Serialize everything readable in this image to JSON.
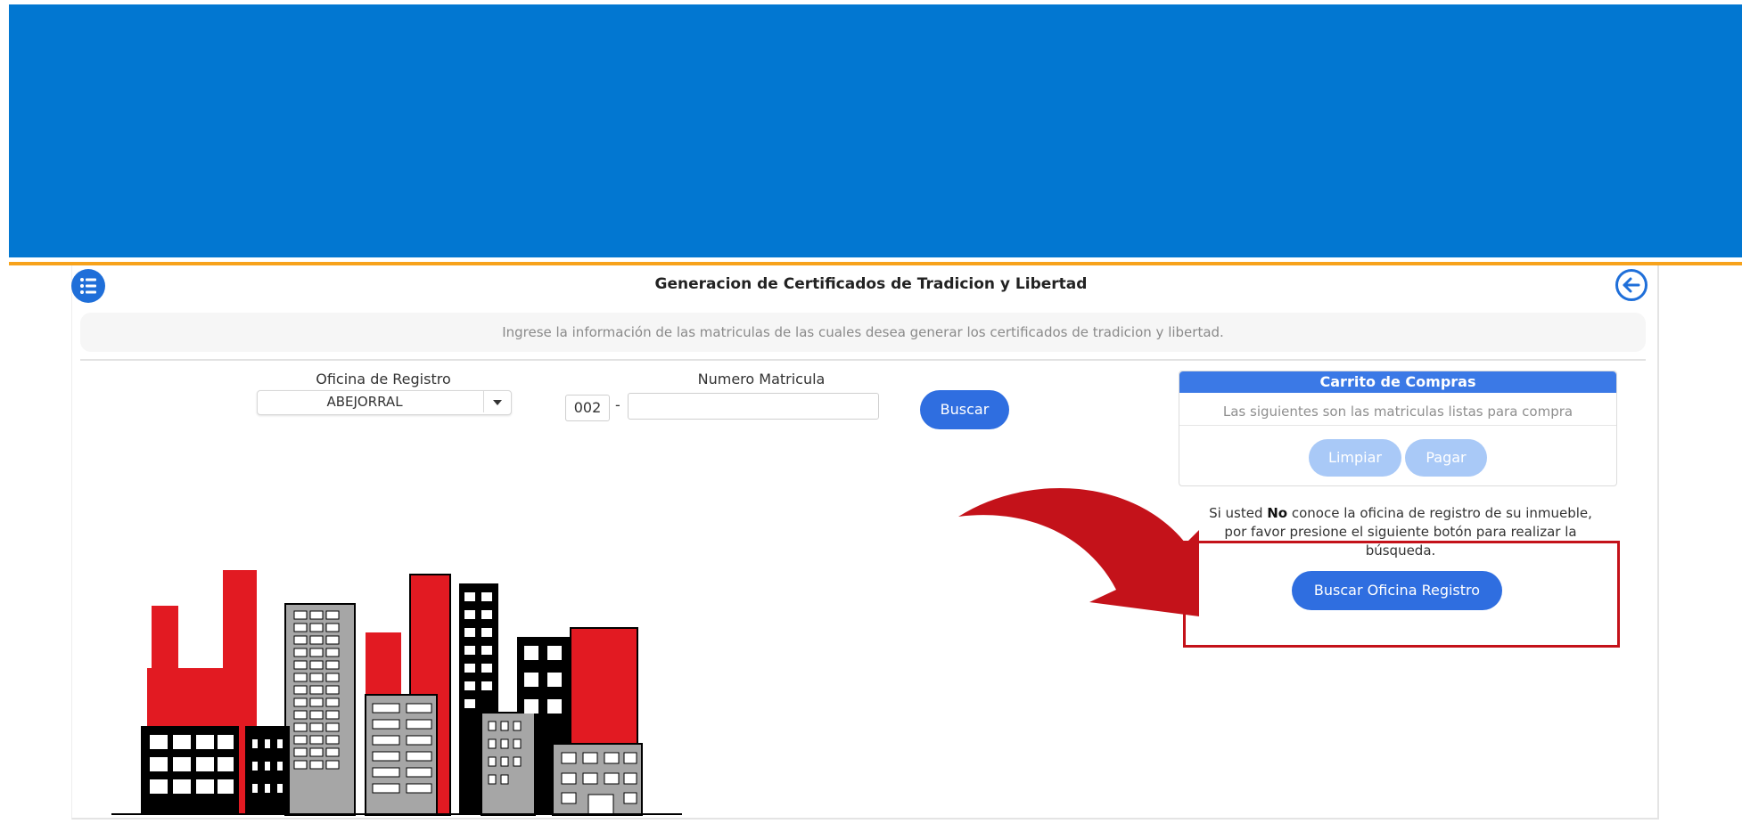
{
  "page": {
    "title": "Generacion de Certificados de Tradicion y Libertad",
    "info": "Ingrese la información de las matriculas de las cuales desea generar los certificados de tradicion y libertad."
  },
  "search": {
    "office_label": "Oficina de Registro",
    "office_value": "ABEJORRAL",
    "matricula_label": "Numero Matricula",
    "matricula_prefix": "002",
    "matricula_separator": "-",
    "matricula_value": "",
    "search_button": "Buscar"
  },
  "cart": {
    "title": "Carrito de Compras",
    "description": "Las siguientes son las matriculas listas para compra",
    "clear_button": "Limpiar",
    "pay_button": "Pagar"
  },
  "help": {
    "text_before": "Si usted ",
    "text_bold": "No",
    "text_after": " conoce la oficina de registro de su inmueble, por favor presione el siguiente botón para realizar la búsqueda.",
    "button": "Buscar Oficina Registro"
  },
  "colors": {
    "banner": "#0277d1",
    "accent": "#f7a21b",
    "primary_button": "#2f6ee0",
    "disabled_button": "#a9c9f7",
    "highlight": "#c4121a"
  },
  "icons": {
    "menu": "list-icon",
    "back": "arrow-left-circle-icon"
  }
}
